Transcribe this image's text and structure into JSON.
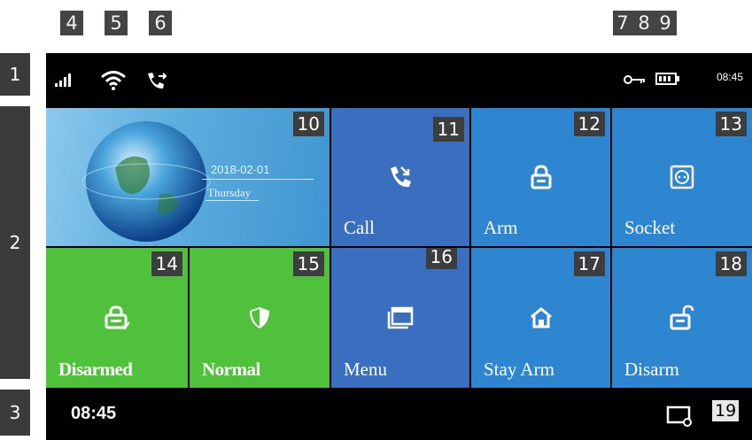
{
  "callouts": {
    "signal": "4",
    "wifi": "5",
    "call": "6",
    "status_right": "7 8 9",
    "section_status": "1",
    "section_main": "2",
    "section_footer": "3",
    "footer_screen": "19"
  },
  "status_bar": {
    "time": "08:45",
    "icons": [
      "signal-icon",
      "wifi-icon",
      "call-forward-icon",
      "key-icon",
      "battery-icon"
    ]
  },
  "tiles": [
    {
      "id": "10",
      "label": "",
      "date": "2018-02-01",
      "weekday": "Thursday",
      "color": "#4ea6d8",
      "icon": "globe-icon"
    },
    {
      "id": "11",
      "label": "Call",
      "color": "#3a6fbf",
      "icon": "phone-icon"
    },
    {
      "id": "12",
      "label": "Arm",
      "color": "#2f86d0",
      "icon": "lock-icon"
    },
    {
      "id": "13",
      "label": "Socket",
      "color": "#2f86d0",
      "icon": "socket-icon"
    },
    {
      "id": "14",
      "label": "Disarmed",
      "color": "#4fc13b",
      "icon": "disarmed-lock-icon"
    },
    {
      "id": "15",
      "label": "Normal",
      "color": "#4fc13b",
      "icon": "shield-icon"
    },
    {
      "id": "16",
      "label": "Menu",
      "color": "#3a6fbf",
      "icon": "menu-window-icon"
    },
    {
      "id": "17",
      "label": "Stay Arm",
      "color": "#2f86d0",
      "icon": "home-icon"
    },
    {
      "id": "18",
      "label": "Disarm",
      "color": "#2f86d0",
      "icon": "unlock-icon"
    }
  ],
  "footer": {
    "time": "08:45",
    "icon": "screen-settings-icon"
  }
}
